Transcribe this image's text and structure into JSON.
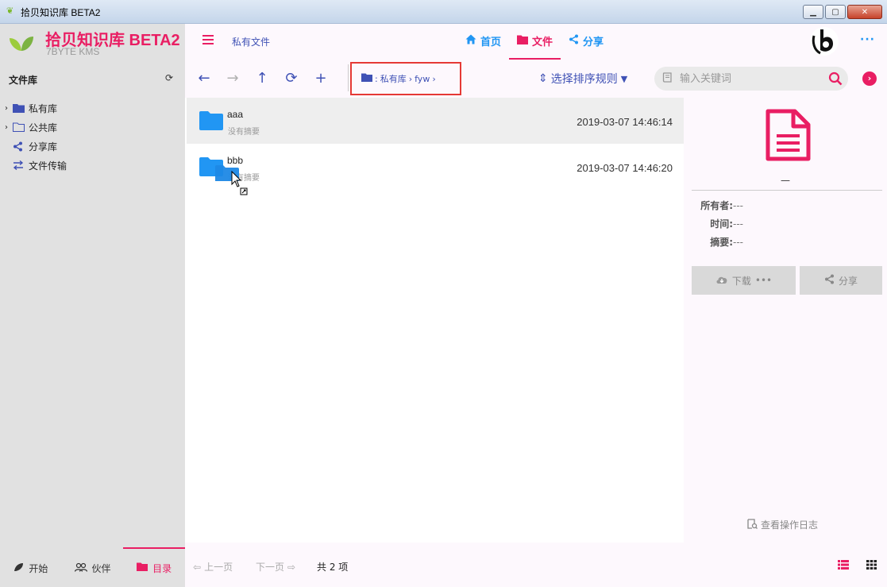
{
  "window": {
    "title": "拾贝知识库 BETA2"
  },
  "brand": {
    "title": "拾贝知识库 BETA2",
    "subtitle": "7BYTE KMS"
  },
  "sidebar": {
    "header": "文件库",
    "items": [
      {
        "label": "私有库",
        "icon": "folder-solid-icon"
      },
      {
        "label": "公共库",
        "icon": "folder-outline-icon"
      },
      {
        "label": "分享库",
        "icon": "share-icon"
      },
      {
        "label": "文件传输",
        "icon": "transfer-icon"
      }
    ],
    "footer_tabs": [
      {
        "label": "开始",
        "icon": "leaf-icon"
      },
      {
        "label": "伙伴",
        "icon": "users-icon"
      },
      {
        "label": "目录",
        "icon": "folder-icon",
        "active": true
      }
    ]
  },
  "topbar": {
    "title": "私有文件",
    "nav": [
      {
        "label": "首页",
        "icon": "home-icon"
      },
      {
        "label": "文件",
        "icon": "folder-icon",
        "active": true
      },
      {
        "label": "分享",
        "icon": "share-icon"
      }
    ],
    "more": "···"
  },
  "toolbar": {
    "breadcrumb": [
      "私有库",
      "fyw"
    ],
    "sort_label": "选择排序规则",
    "search_placeholder": "输入关键词"
  },
  "files": [
    {
      "name": "aaa",
      "desc": "没有摘要",
      "date": "2019-03-07 14:46:14",
      "selected": true
    },
    {
      "name": "bbb",
      "desc": "没有摘要",
      "date": "2019-03-07 14:46:20",
      "selected": false
    }
  ],
  "detail": {
    "name": "—",
    "owner_label": "所有者:",
    "owner_value": "---",
    "time_label": "时间:",
    "time_value": "---",
    "summary_label": "摘要:",
    "summary_value": "---",
    "download_label": "下载",
    "download_more": "•••",
    "share_label": "分享",
    "log_label": "查看操作日志"
  },
  "pagination": {
    "prev": "上一页",
    "next": "下一页",
    "total": "共 2 项"
  },
  "colors": {
    "accent": "#e91e63",
    "primary": "#3f51b5",
    "link": "#2196f3",
    "folder": "#2196f3"
  }
}
